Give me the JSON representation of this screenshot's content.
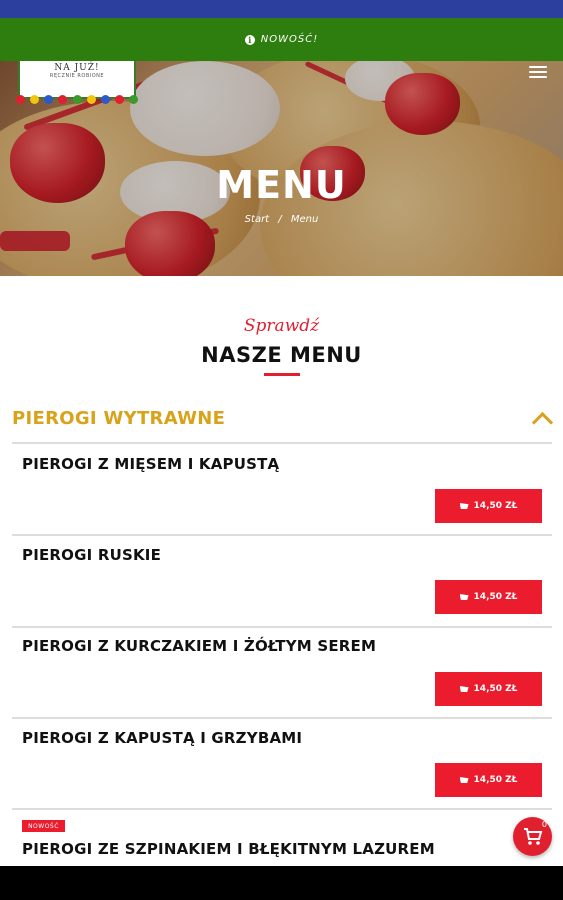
{
  "news_bar": {
    "icon": "info-icon",
    "text": "NOWOŚĆ!",
    "color": "#2e7d0f"
  },
  "logo": {
    "name": "NA JUŻ!",
    "subtitle": "RĘCZNIE ROBIONE"
  },
  "hero": {
    "title": "MENU",
    "breadcrumb_home": "Start",
    "breadcrumb_sep": "/",
    "breadcrumb_current": "Menu"
  },
  "section": {
    "kicker": "Sprawdź",
    "title": "NASZE MENU"
  },
  "category": {
    "label": "PIEROGI WYTRAWNE",
    "expanded": true,
    "color": "#d9a21b"
  },
  "items": [
    {
      "name": "PIEROGI Z MIĘSEM I KAPUSTĄ",
      "price": "14,50 ZŁ"
    },
    {
      "name": "PIEROGI RUSKIE",
      "price": "14,50 ZŁ"
    },
    {
      "name": "PIEROGI Z KURCZAKIEM I ŻÓŁTYM SEREM",
      "price": "14,50 ZŁ"
    },
    {
      "name": "PIEROGI Z KAPUSTĄ I GRZYBAMI",
      "price": "14,50 ZŁ"
    },
    {
      "name": "PIEROGI ZE SZPINAKIEM I BŁĘKITNYM LAZUREM",
      "badge": "NOWOŚĆ"
    }
  ],
  "cart": {
    "count": "0",
    "icon": "cart-icon"
  },
  "accent_color": "#ea1c2d"
}
